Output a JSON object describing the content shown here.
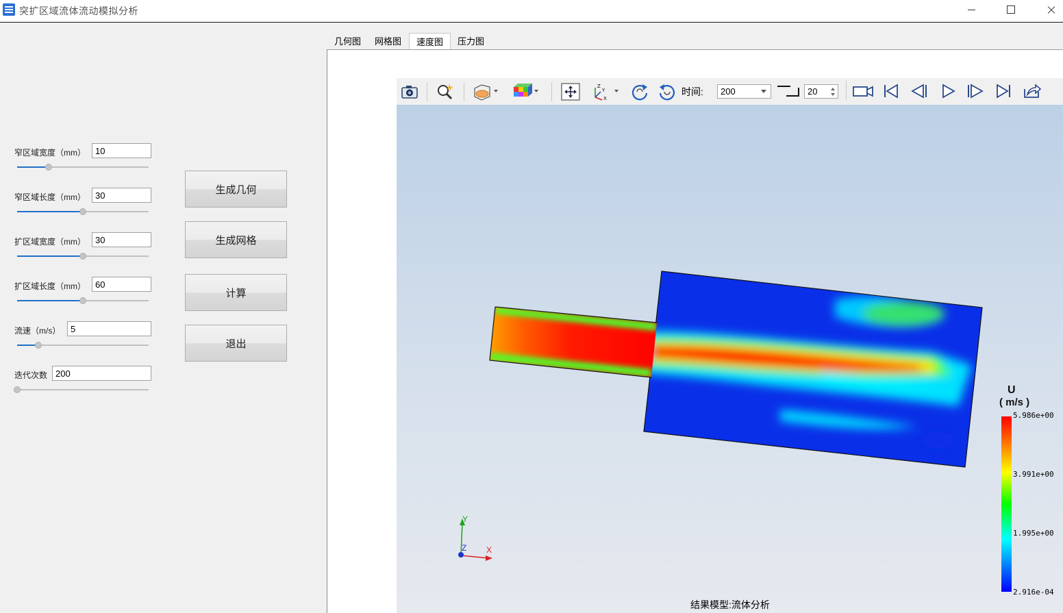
{
  "window": {
    "title": "突扩区域流体流动模拟分析",
    "icon": "app-icon"
  },
  "params": [
    {
      "label": "窄区域宽度（mm）",
      "value": "10",
      "slider_fraction": 0.24
    },
    {
      "label": "窄区域长度（mm）",
      "value": "30",
      "slider_fraction": 0.5
    },
    {
      "label": "扩区域宽度（mm）",
      "value": "30",
      "slider_fraction": 0.5
    },
    {
      "label": "扩区域长度（mm）",
      "value": "60",
      "slider_fraction": 0.5
    },
    {
      "label": "流速（m/s）",
      "value": "5",
      "slider_fraction": 0.16
    },
    {
      "label": "迭代次数",
      "value": "200",
      "slider_fraction": 0.0
    }
  ],
  "buttons": {
    "generate_geometry": "生成几何",
    "generate_mesh": "生成网格",
    "compute": "计算",
    "exit": "退出"
  },
  "tabs": [
    {
      "label": "几何图",
      "active": false
    },
    {
      "label": "网格图",
      "active": false
    },
    {
      "label": "速度图",
      "active": true
    },
    {
      "label": "压力图",
      "active": false
    }
  ],
  "toolbar": {
    "time_label": "时间:",
    "time_value": "200",
    "step_value": "20",
    "icons": [
      "camera-icon",
      "zoom-icon",
      "slice-icon",
      "color-cube-icon",
      "fit-view-icon",
      "axes-icon",
      "rotate-cw-icon",
      "rotate-ccw-icon",
      "step-icon",
      "record-icon",
      "first-frame-icon",
      "prev-frame-icon",
      "play-icon",
      "next-frame-icon",
      "last-frame-icon",
      "export-icon"
    ]
  },
  "viewport": {
    "caption": "结果模型:流体分析",
    "legend": {
      "title": "U",
      "unit": "( m/s )",
      "max": "5.986e+00",
      "v2": "3.991e+00",
      "v3": "1.995e+00",
      "min": "2.916e-04"
    },
    "axes": {
      "y": "Y",
      "z": "Z",
      "x": "X"
    }
  }
}
